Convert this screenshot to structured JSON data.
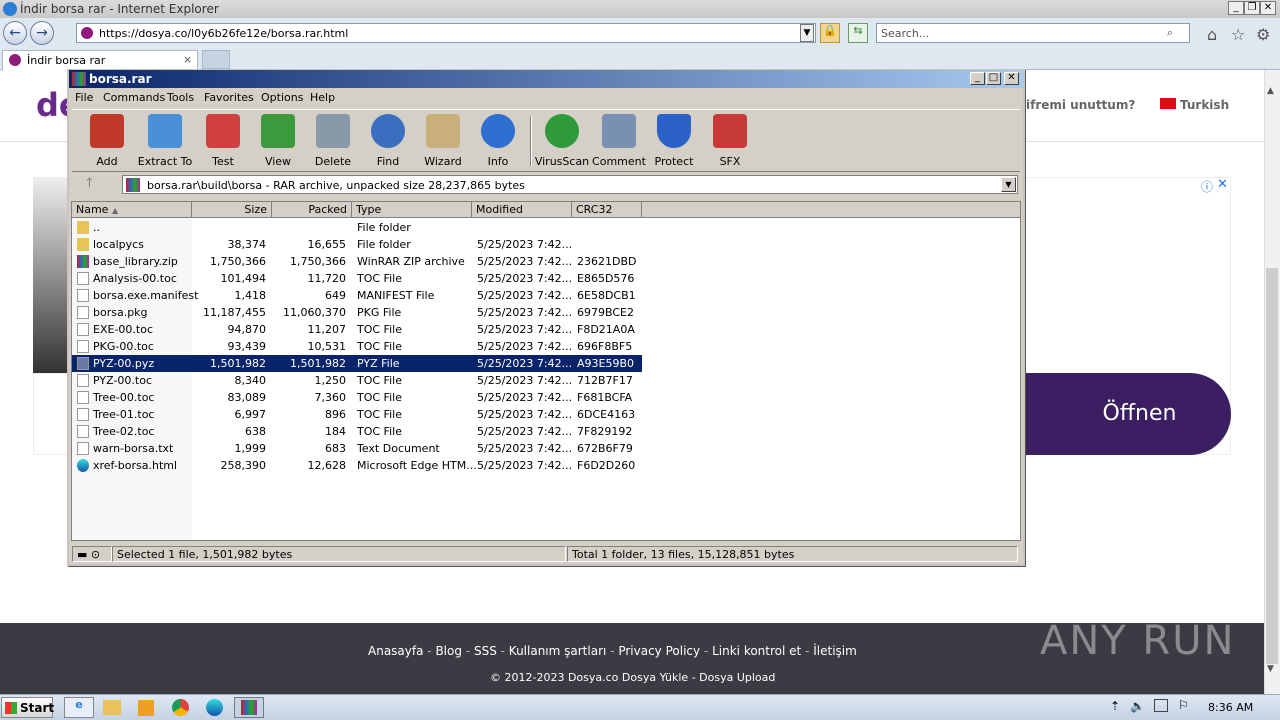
{
  "ie": {
    "title": "İndir borsa rar - Internet Explorer",
    "url": "https://dosya.co/l0y6b26fe12e/borsa.rar.html",
    "search_placeholder": "Search...",
    "tab_label": "İndir borsa rar"
  },
  "site": {
    "forgot": "ifremi unuttum?",
    "lang": "Turkish",
    "open_button": "Öffnen",
    "footer_links": [
      "Anasayfa",
      "Blog",
      "SSS",
      "Kullanım şartları",
      "Privacy Policy",
      "Linki kontrol et",
      "İletişim"
    ],
    "footer_copy": "© 2012-2023 Dosya.co Dosya Yükle - Dosya Upload",
    "watermark": "ANY RUN"
  },
  "winrar": {
    "title": "borsa.rar",
    "menu": [
      "File",
      "Commands",
      "Tools",
      "Favorites",
      "Options",
      "Help"
    ],
    "toolbar": [
      {
        "label": "Add",
        "color": "#c0392b"
      },
      {
        "label": "Extract To",
        "color": "#4a90d9"
      },
      {
        "label": "Test",
        "color": "#d04040"
      },
      {
        "label": "View",
        "color": "#3c9a3c"
      },
      {
        "label": "Delete",
        "color": "#8899aa"
      },
      {
        "label": "Find",
        "color": "#3a6fc0"
      },
      {
        "label": "Wizard",
        "color": "#c9b07a"
      },
      {
        "label": "Info",
        "color": "#2f6fcf"
      },
      {
        "label": "VirusScan",
        "color": "#2f9a3a"
      },
      {
        "label": "Comment",
        "color": "#7a90b0"
      },
      {
        "label": "Protect",
        "color": "#2a62c8"
      },
      {
        "label": "SFX",
        "color": "#c83a3a"
      }
    ],
    "path": "borsa.rar\\build\\borsa - RAR archive, unpacked size 28,237,865 bytes",
    "columns": [
      "Name",
      "Size",
      "Packed",
      "Type",
      "Modified",
      "CRC32"
    ],
    "files": [
      {
        "name": "..",
        "size": "",
        "packed": "",
        "type": "File folder",
        "modified": "",
        "crc": "",
        "icon": "folder"
      },
      {
        "name": "localpycs",
        "size": "38,374",
        "packed": "16,655",
        "type": "File folder",
        "modified": "5/25/2023 7:42...",
        "crc": "",
        "icon": "folder"
      },
      {
        "name": "base_library.zip",
        "size": "1,750,366",
        "packed": "1,750,366",
        "type": "WinRAR ZIP archive",
        "modified": "5/25/2023 7:42...",
        "crc": "23621DBD",
        "icon": "archive"
      },
      {
        "name": "Analysis-00.toc",
        "size": "101,494",
        "packed": "11,720",
        "type": "TOC File",
        "modified": "5/25/2023 7:42...",
        "crc": "E865D576",
        "icon": "file"
      },
      {
        "name": "borsa.exe.manifest",
        "size": "1,418",
        "packed": "649",
        "type": "MANIFEST File",
        "modified": "5/25/2023 7:42...",
        "crc": "6E58DCB1",
        "icon": "file"
      },
      {
        "name": "borsa.pkg",
        "size": "11,187,455",
        "packed": "11,060,370",
        "type": "PKG File",
        "modified": "5/25/2023 7:42...",
        "crc": "6979BCE2",
        "icon": "file"
      },
      {
        "name": "EXE-00.toc",
        "size": "94,870",
        "packed": "11,207",
        "type": "TOC File",
        "modified": "5/25/2023 7:42...",
        "crc": "F8D21A0A",
        "icon": "file"
      },
      {
        "name": "PKG-00.toc",
        "size": "93,439",
        "packed": "10,531",
        "type": "TOC File",
        "modified": "5/25/2023 7:42...",
        "crc": "696F8BF5",
        "icon": "file"
      },
      {
        "name": "PYZ-00.pyz",
        "size": "1,501,982",
        "packed": "1,501,982",
        "type": "PYZ File",
        "modified": "5/25/2023 7:42...",
        "crc": "A93E59B0",
        "icon": "file",
        "selected": true
      },
      {
        "name": "PYZ-00.toc",
        "size": "8,340",
        "packed": "1,250",
        "type": "TOC File",
        "modified": "5/25/2023 7:42...",
        "crc": "712B7F17",
        "icon": "file"
      },
      {
        "name": "Tree-00.toc",
        "size": "83,089",
        "packed": "7,360",
        "type": "TOC File",
        "modified": "5/25/2023 7:42...",
        "crc": "F681BCFA",
        "icon": "file"
      },
      {
        "name": "Tree-01.toc",
        "size": "6,997",
        "packed": "896",
        "type": "TOC File",
        "modified": "5/25/2023 7:42...",
        "crc": "6DCE4163",
        "icon": "file"
      },
      {
        "name": "Tree-02.toc",
        "size": "638",
        "packed": "184",
        "type": "TOC File",
        "modified": "5/25/2023 7:42...",
        "crc": "7F829192",
        "icon": "file"
      },
      {
        "name": "warn-borsa.txt",
        "size": "1,999",
        "packed": "683",
        "type": "Text Document",
        "modified": "5/25/2023 7:42...",
        "crc": "672B6F79",
        "icon": "file"
      },
      {
        "name": "xref-borsa.html",
        "size": "258,390",
        "packed": "12,628",
        "type": "Microsoft Edge HTM...",
        "modified": "5/25/2023 7:42...",
        "crc": "F6D2D260",
        "icon": "edge"
      }
    ],
    "status_left": "Selected 1 file, 1,501,982 bytes",
    "status_right": "Total 1 folder, 13 files, 15,128,851 bytes"
  },
  "taskbar": {
    "start": "Start",
    "time": "8:36 AM"
  }
}
